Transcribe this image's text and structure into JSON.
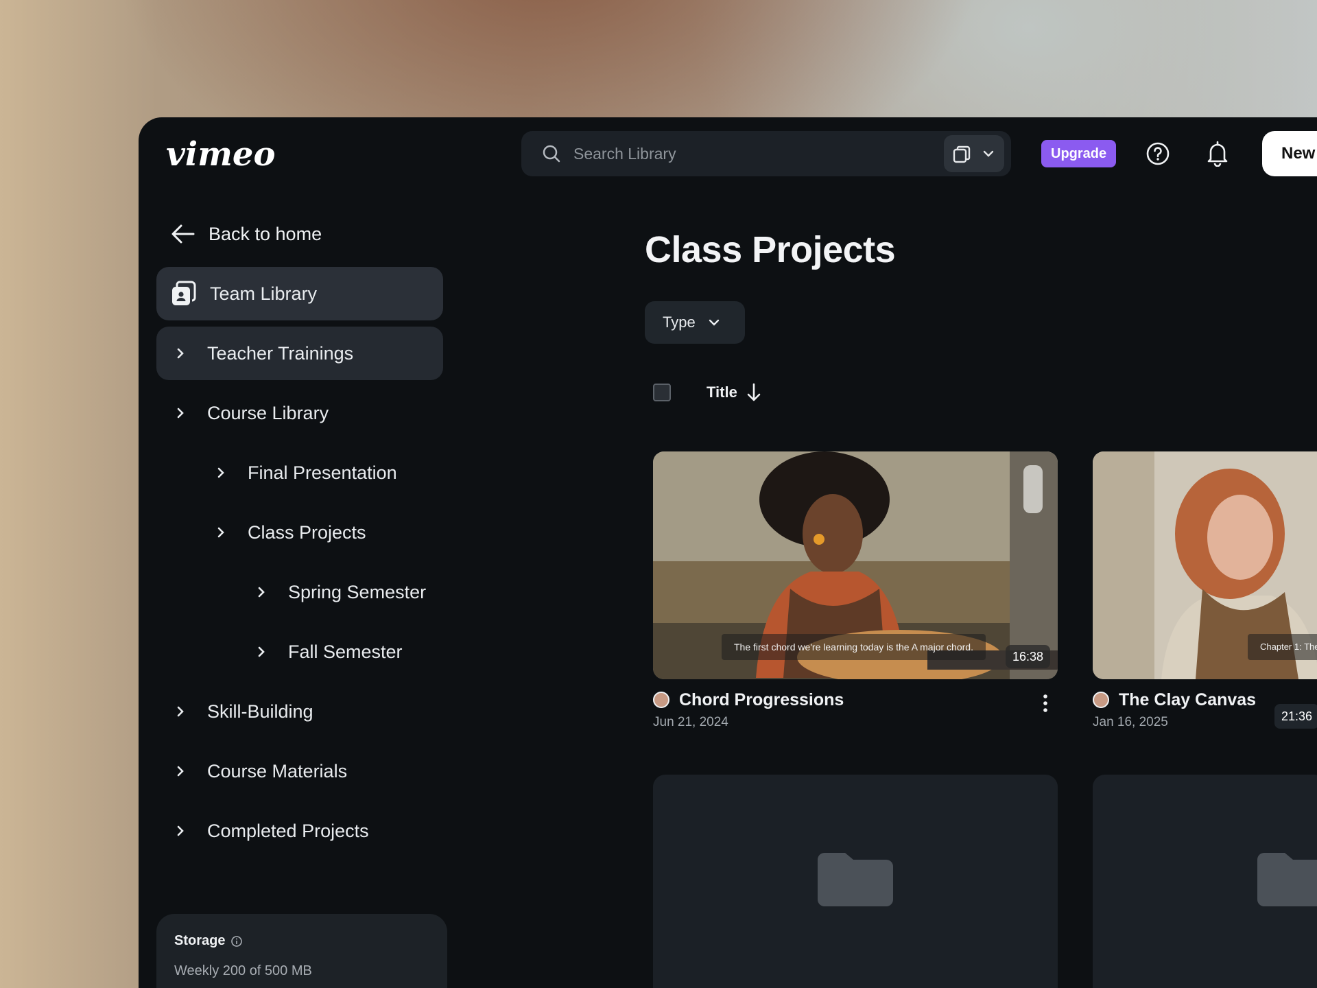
{
  "header": {
    "logo_text": "vimeo",
    "search_placeholder": "Search Library",
    "upgrade_label": "Upgrade",
    "new_label": "New"
  },
  "sidebar": {
    "back_label": "Back to home",
    "items": [
      {
        "label": "Team Library"
      },
      {
        "label": "Teacher Trainings"
      },
      {
        "label": "Course Library"
      },
      {
        "label": "Final Presentation"
      },
      {
        "label": "Class Projects"
      },
      {
        "label": "Spring Semester"
      },
      {
        "label": "Fall Semester"
      },
      {
        "label": "Skill-Building"
      },
      {
        "label": "Course Materials"
      },
      {
        "label": "Completed Projects"
      }
    ],
    "storage": {
      "title": "Storage",
      "usage": "Weekly  200 of 500 MB"
    }
  },
  "main": {
    "page_title": "Class Projects",
    "type_filter_label": "Type",
    "sort_label": "Title",
    "videos": [
      {
        "title": "Chord Progressions",
        "date": "Jun 21, 2024",
        "duration": "16:38",
        "caption": "The first chord we're learning today is the A major chord."
      },
      {
        "title": "The Clay Canvas",
        "date": "Jan 16, 2025",
        "duration": "21:36",
        "caption": "Chapter 1: The"
      }
    ]
  },
  "colors": {
    "app_bg": "#0d1013",
    "accent": "#8b5bf0",
    "active_nav": "#2b3038"
  }
}
